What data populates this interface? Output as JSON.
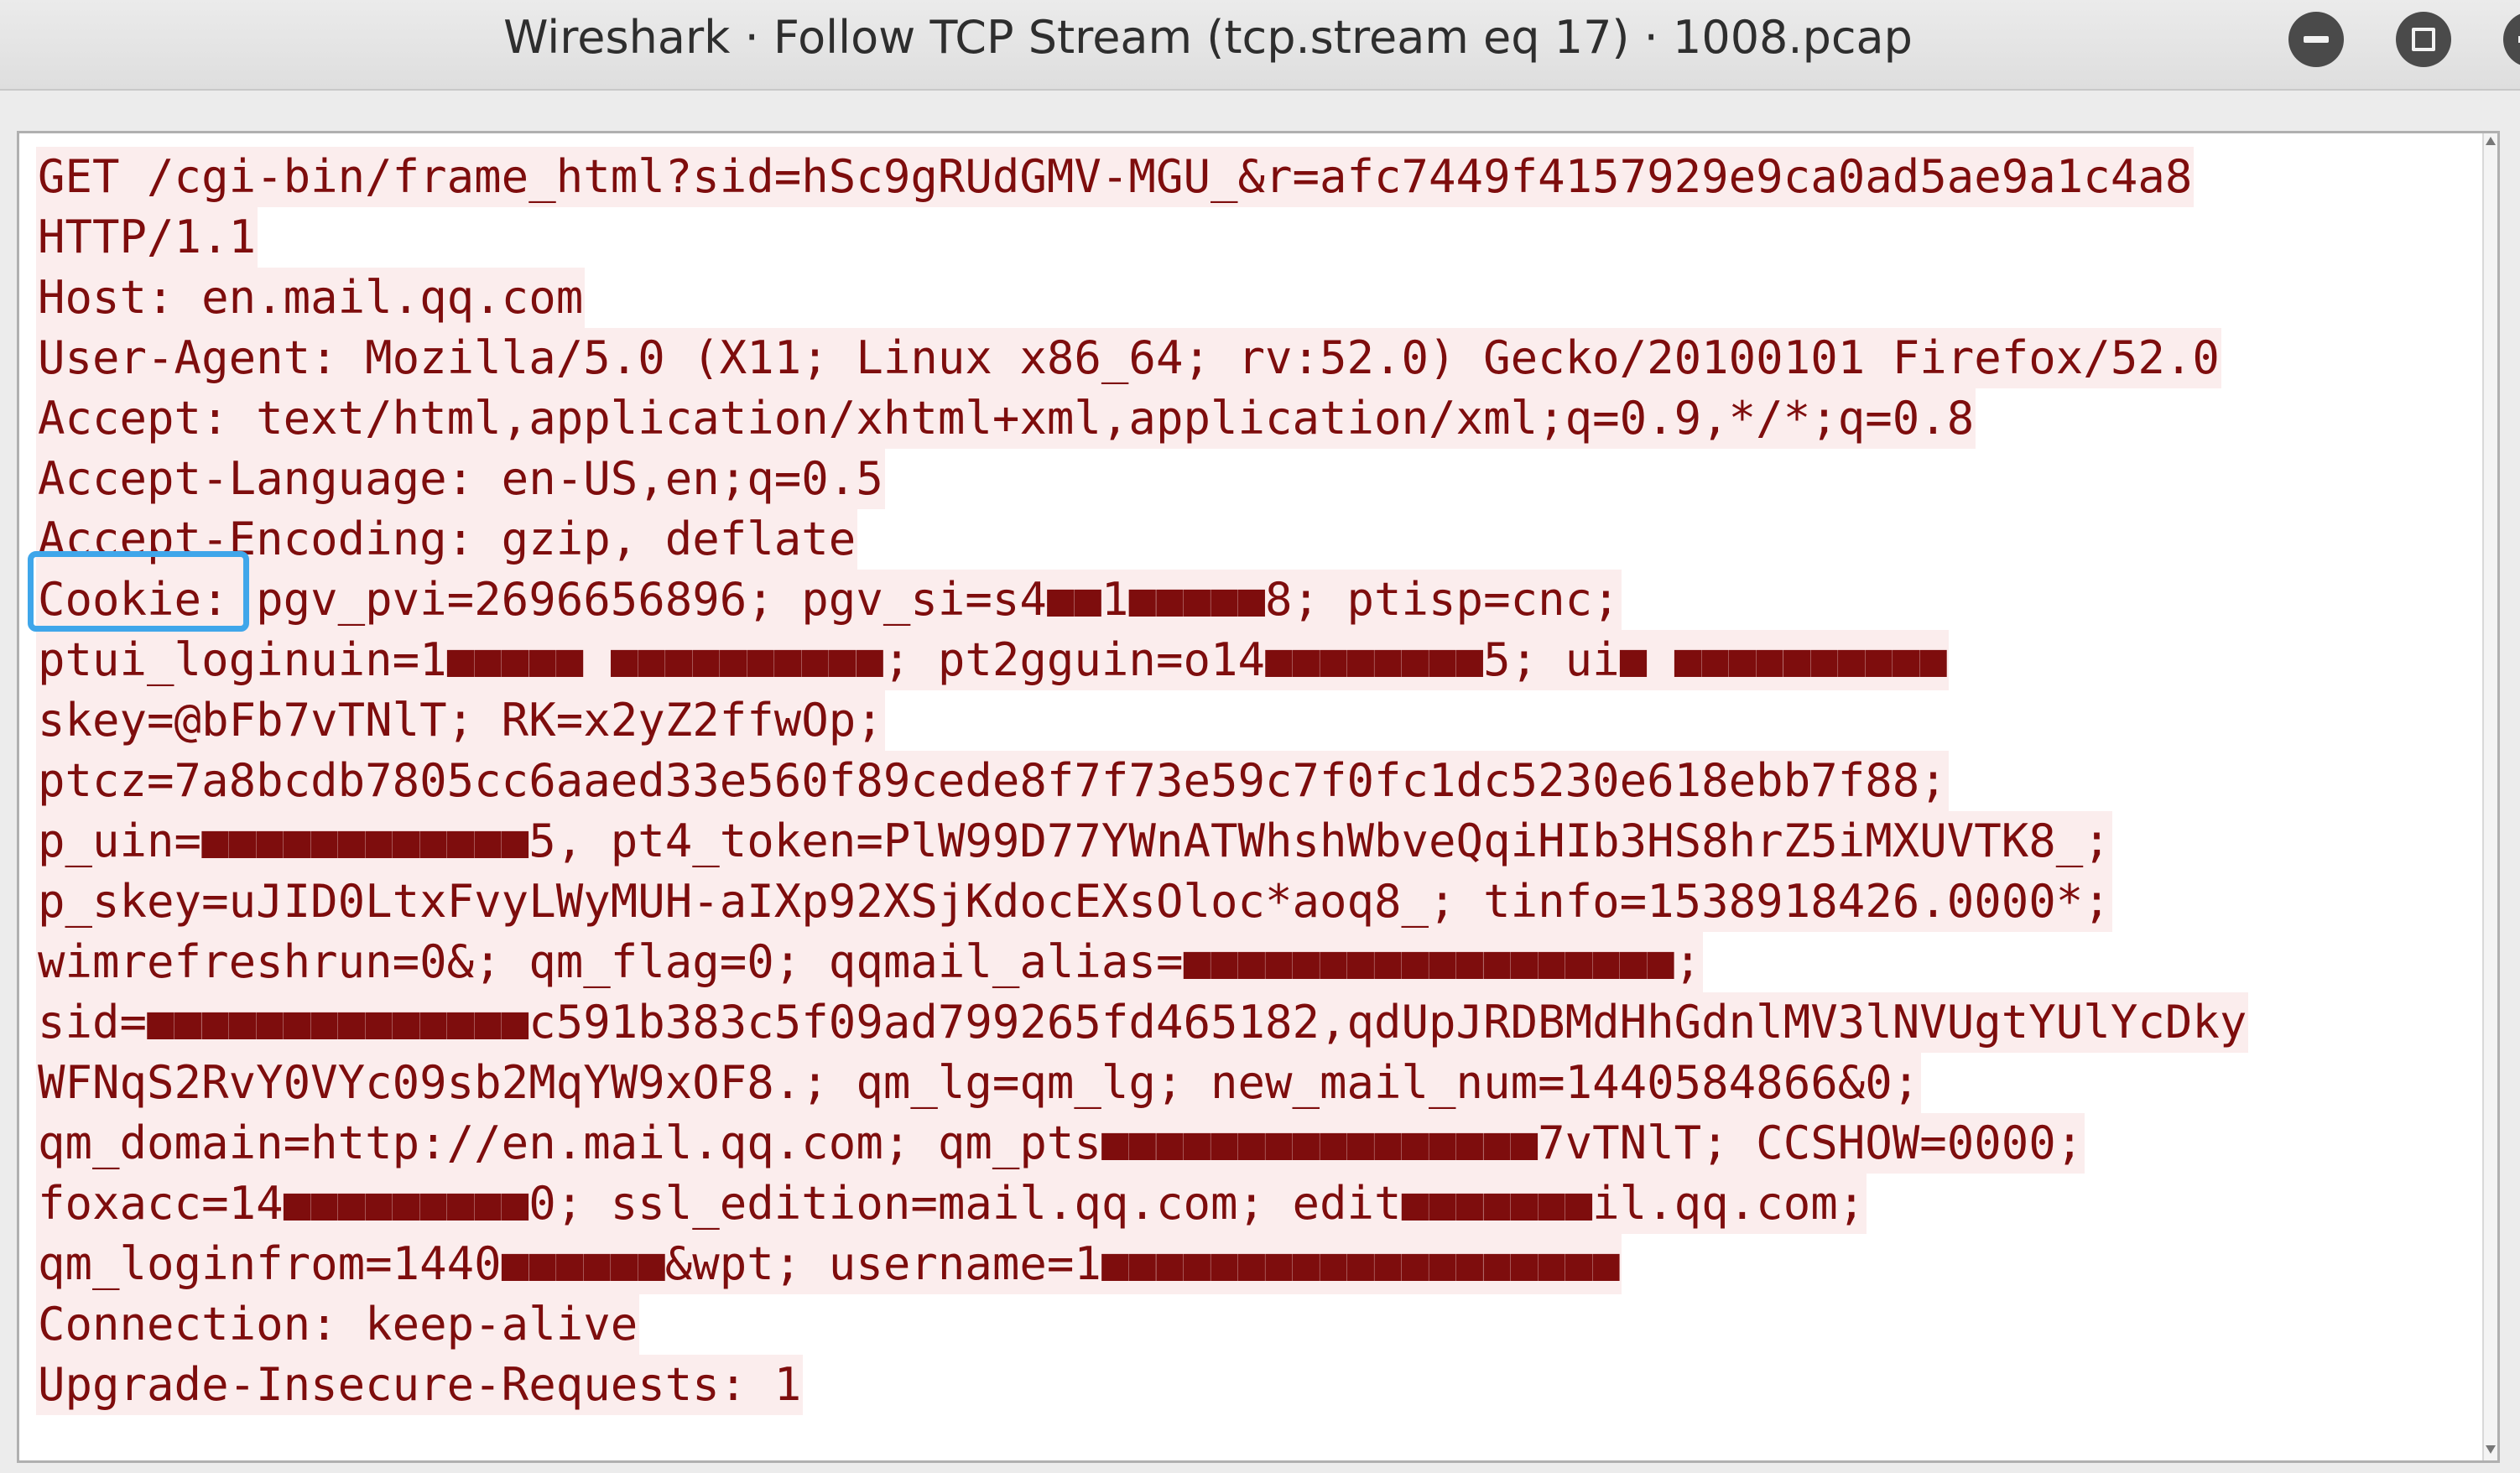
{
  "window": {
    "title": "Wireshark · Follow TCP Stream (tcp.stream eq 17) · 1008.pcap",
    "minimize_icon": "minus-icon",
    "maximize_icon": "square-icon",
    "close_icon": "close-icon"
  },
  "stream": {
    "text_color": "#7e0d0d",
    "background_color": "#fbeded",
    "highlight_color": "#3fa6ea",
    "lines": [
      "GET /cgi-bin/frame_html?sid=hSc9gRUdGMV-MGU_&r=afc7449f4157929e9ca0ad5ae9a1c4a8",
      "HTTP/1.1",
      "Host: en.mail.qq.com",
      "User-Agent: Mozilla/5.0 (X11; Linux x86_64; rv:52.0) Gecko/20100101 Firefox/52.0",
      "Accept: text/html,application/xhtml+xml,application/xml;q=0.9,*/*;q=0.8",
      "Accept-Language: en-US,en;q=0.5",
      "Accept-Encoding: gzip, deflate",
      "Cookie: pgv_pvi=2696656896; pgv_si=s4■■1■■■■■8; ptisp=cnc;",
      "ptui_loginuin=1■■■■■ ■■■■■■■■■■; pt2gguin=o14■■■■■■■■5; ui■ ■■■■■■■■■■",
      "skey=@bFb7vTNlT; RK=x2yZ2ffwOp;",
      "ptcz=7a8bcdb7805cc6aaed33e560f89cede8f7f73e59c7f0fc1dc5230e618ebb7f88;",
      "p_uin=■■■■■■■■■■■■5, pt4_token=PlW99D77YWnATWhshWbveQqiHIb3HS8hrZ5iMXUVTK8_;",
      "p_skey=uJID0LtxFvyLWyMUH-aIXp92XSjKdocEXsOloc*aoq8_; tinfo=1538918426.0000*;",
      "wimrefreshrun=0&; qm_flag=0; qqmail_alias=■■■■■■■■■■■■■■■■■■;",
      "sid=■■■■■■■■■■■■■■c591b383c5f09ad799265fd465182,qdUpJRDBMdHhGdnlMV3lNVUgtYUlYcDky",
      "WFNqS2RvY0VYc09sb2MqYW9xOF8.; qm_lg=qm_lg; new_mail_num=1440584866&0;",
      "qm_domain=http://en.mail.qq.com; qm_pts■■■■■■■■■■■■■■■■7vTNlT; CCSHOW=0000;",
      "foxacc=14■■■■■■■■■0; ssl_edition=mail.qq.com; edit■■■■■■■il.qq.com;",
      "qm_loginfrom=1440■■■■■■&wpt; username=1■■■■■■■■■■■■■■■■■■■",
      "Connection: keep-alive",
      "Upgrade-Insecure-Requests: 1"
    ]
  }
}
